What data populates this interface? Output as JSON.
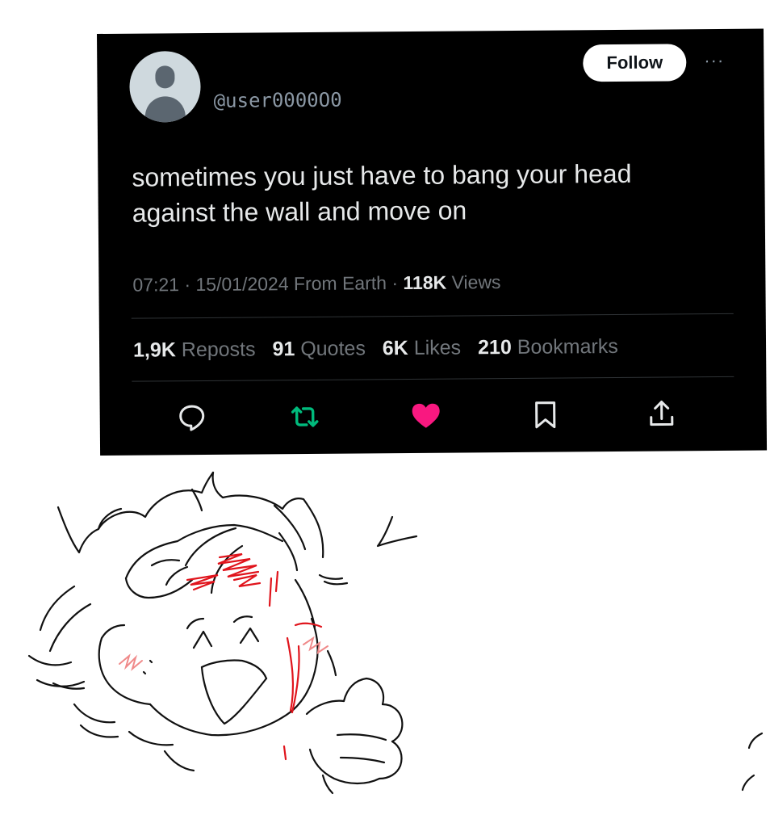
{
  "tweet": {
    "handle": "@user0000O0",
    "follow_label": "Follow",
    "more_label": "···",
    "text": "sometimes you just have to bang your head against the wall and move on",
    "meta": {
      "time": "07:21",
      "sep1": " · ",
      "date": "15/01/2024",
      "source": " From Earth",
      "sep2": " · ",
      "views_count": "118K",
      "views_label": " Views"
    },
    "stats": [
      {
        "count": "1,9K",
        "label": "Reposts"
      },
      {
        "count": "91",
        "label": "Quotes"
      },
      {
        "count": "6K",
        "label": "Likes"
      },
      {
        "count": "210",
        "label": "Bookmarks"
      }
    ],
    "actions": [
      {
        "name": "reply",
        "icon": "reply-icon"
      },
      {
        "name": "repost",
        "icon": "repost-icon",
        "color": "#00ba7c"
      },
      {
        "name": "like",
        "icon": "heart-icon",
        "color": "#f91880"
      },
      {
        "name": "bookmark",
        "icon": "bookmark-icon"
      },
      {
        "name": "share",
        "icon": "share-icon"
      }
    ]
  },
  "colors": {
    "card_background": "#000000",
    "text_primary": "#e7e9ea",
    "text_secondary": "#71767b",
    "repost_green": "#00ba7c",
    "like_pink": "#f91880",
    "follow_button": "#ffffff",
    "doodle_blood": "#e0141c",
    "doodle_blush": "#f08a8a"
  },
  "drawing": {
    "description_icon": "thumbs-up-doodle-character"
  }
}
